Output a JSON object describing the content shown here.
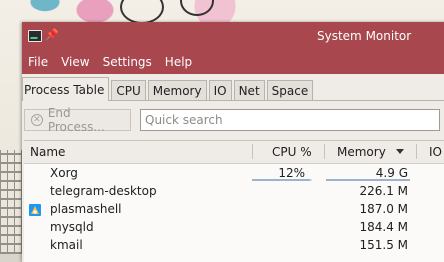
{
  "window": {
    "title": "System Monitor"
  },
  "menubar": {
    "items": [
      "File",
      "View",
      "Settings",
      "Help"
    ]
  },
  "tabs": [
    {
      "label": "Process Table",
      "active": true
    },
    {
      "label": "CPU",
      "active": false
    },
    {
      "label": "Memory",
      "active": false
    },
    {
      "label": "IO",
      "active": false
    },
    {
      "label": "Net",
      "active": false
    },
    {
      "label": "Space",
      "active": false
    }
  ],
  "toolbar": {
    "end_process_label": "End Process...",
    "search_placeholder": "Quick search"
  },
  "table": {
    "columns": {
      "name": "Name",
      "cpu": "CPU %",
      "memory": "Memory",
      "io": "IO"
    },
    "sort_column": "memory",
    "rows": [
      {
        "name": "Xorg",
        "cpu": "12%",
        "memory": "4.9 G",
        "cpu_fraction": 0.12,
        "icon": ""
      },
      {
        "name": "telegram-desktop",
        "cpu": "",
        "memory": "226.1 M",
        "icon": ""
      },
      {
        "name": "plasmashell",
        "cpu": "",
        "memory": "187.0 M",
        "icon": "plasma-icon"
      },
      {
        "name": "mysqld",
        "cpu": "",
        "memory": "184.4 M",
        "icon": ""
      },
      {
        "name": "kmail",
        "cpu": "",
        "memory": "151.5 M",
        "icon": ""
      }
    ]
  },
  "colors": {
    "titlebar": "#a8474d",
    "accent_bar": "#9eb3c7"
  }
}
